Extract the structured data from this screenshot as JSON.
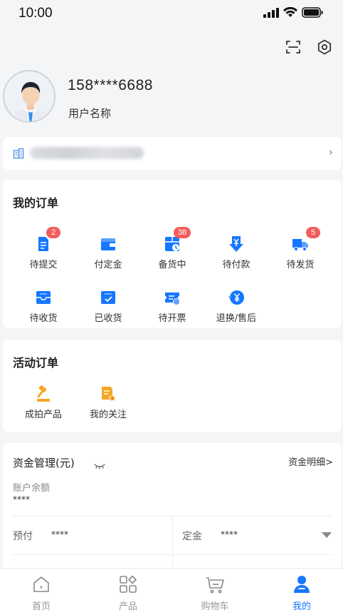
{
  "status_bar": {
    "time": "10:00"
  },
  "profile": {
    "phone": "158****6688",
    "username": "用户名称"
  },
  "company": {
    "name_blurred": "上海大众股份有限公司"
  },
  "my_orders": {
    "title": "我的订单",
    "items": [
      {
        "label": "待提交",
        "badge": "2",
        "icon": "document-icon"
      },
      {
        "label": "付定金",
        "badge": "",
        "icon": "wallet-icon"
      },
      {
        "label": "备货中",
        "badge": "38",
        "icon": "box-clock-icon"
      },
      {
        "label": "待付款",
        "badge": "",
        "icon": "yen-download-icon"
      },
      {
        "label": "待发货",
        "badge": "5",
        "icon": "truck-icon"
      },
      {
        "label": "待收货",
        "badge": "",
        "icon": "inbox-icon"
      },
      {
        "label": "已收货",
        "badge": "",
        "icon": "inbox-check-icon"
      },
      {
        "label": "待开票",
        "badge": "",
        "icon": "ticket-icon"
      },
      {
        "label": "退换/售后",
        "badge": "",
        "icon": "yen-refund-icon"
      }
    ]
  },
  "activity_orders": {
    "title": "活动订单",
    "items": [
      {
        "label": "成拍产品",
        "icon": "gavel-icon"
      },
      {
        "label": "我的关注",
        "icon": "doc-star-icon"
      }
    ]
  },
  "funds": {
    "title": "资金管理(元)",
    "detail_link": "资金明细>",
    "balance_label": "账户余额",
    "balance_value": "****",
    "prepay_label": "预付",
    "prepay_value": "****",
    "deposit_label": "定金",
    "deposit_value": "****"
  },
  "tabbar": {
    "items": [
      {
        "label": "首页",
        "icon": "home-icon"
      },
      {
        "label": "产品",
        "icon": "grid-icon"
      },
      {
        "label": "购物车",
        "icon": "cart-icon"
      },
      {
        "label": "我的",
        "icon": "user-icon",
        "active": true
      }
    ]
  },
  "colors": {
    "accent": "#1677ff",
    "badge": "#f45b5b",
    "activity_icon": "#f5a623"
  }
}
